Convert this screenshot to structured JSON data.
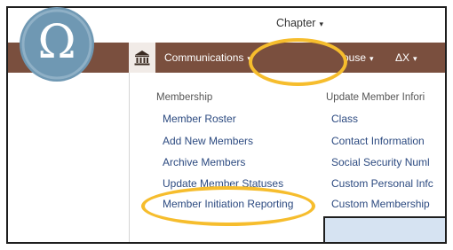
{
  "navbar": {
    "home_icon": "bank-icon",
    "communications": {
      "label": "Communications",
      "caret": "▾"
    },
    "chapter": {
      "label": "Chapter",
      "caret": "▾"
    },
    "house": {
      "label": "ouse",
      "caret": "▾"
    },
    "delta_x": {
      "label": "ΔX",
      "caret": "▾"
    }
  },
  "logo": {
    "glyph": "Ω",
    "icon": "omega-seal-icon"
  },
  "dropdown": {
    "membership": {
      "heading": "Membership",
      "items": [
        "Member Roster",
        "Add New Members",
        "Archive Members",
        "Update Member Statuses",
        "Member Initiation Reporting"
      ]
    },
    "update_member_info": {
      "heading": "Update Member Infori",
      "items": [
        "Class",
        "Contact Information",
        "Social Security Numl",
        "Custom Personal Infc",
        "Custom Membership"
      ]
    }
  },
  "colors": {
    "navbar": "#7a4f3e",
    "highlight": "#f6bd2d",
    "link": "#2c4a80",
    "logo": "#6f98b3"
  }
}
